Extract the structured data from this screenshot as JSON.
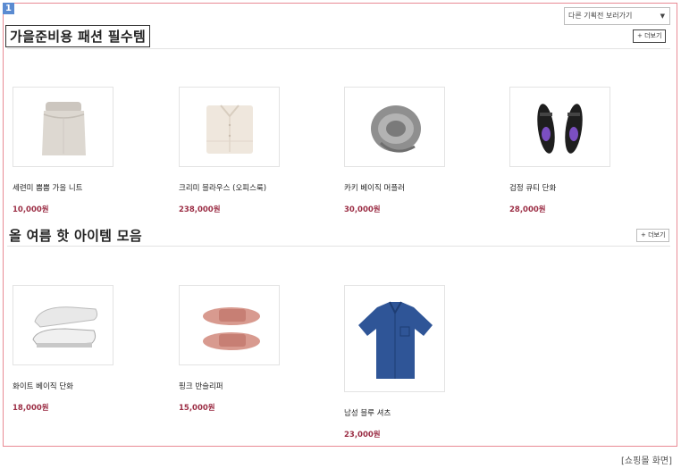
{
  "badge": "1",
  "plan_select": {
    "value": "다른 기획전 보러가기"
  },
  "sections": [
    {
      "title": "가을준비용 패션 필수템",
      "more_label": "+ 더보기",
      "products": [
        {
          "name": "세련미 뿜뿜 가을 니트",
          "price": "10,000원",
          "icon": "sweater-icon"
        },
        {
          "name": "크리미 블라우스 (오피스룩)",
          "price": "238,000원",
          "icon": "blouse-icon"
        },
        {
          "name": "카키 베이직 머플러",
          "price": "30,000원",
          "icon": "scarf-icon"
        },
        {
          "name": "검정 큐티 단화",
          "price": "28,000원",
          "icon": "black-shoes-icon"
        }
      ]
    },
    {
      "title": "올 여름 핫 아이템 모음",
      "more_label": "+ 더보기",
      "products": [
        {
          "name": "화이트 베이직 단화",
          "price": "18,000원",
          "icon": "white-sneakers-icon"
        },
        {
          "name": "핑크 반슬리퍼",
          "price": "15,000원",
          "icon": "pink-slippers-icon"
        },
        {
          "name": "남성 블루 셔츠",
          "price": "23,000원",
          "icon": "blue-shirt-icon"
        }
      ]
    }
  ],
  "caption": "[쇼핑몰 화면]",
  "colors": {
    "frame": "#e98b95",
    "price": "#9c2f46",
    "badge": "#5b8bd1"
  }
}
